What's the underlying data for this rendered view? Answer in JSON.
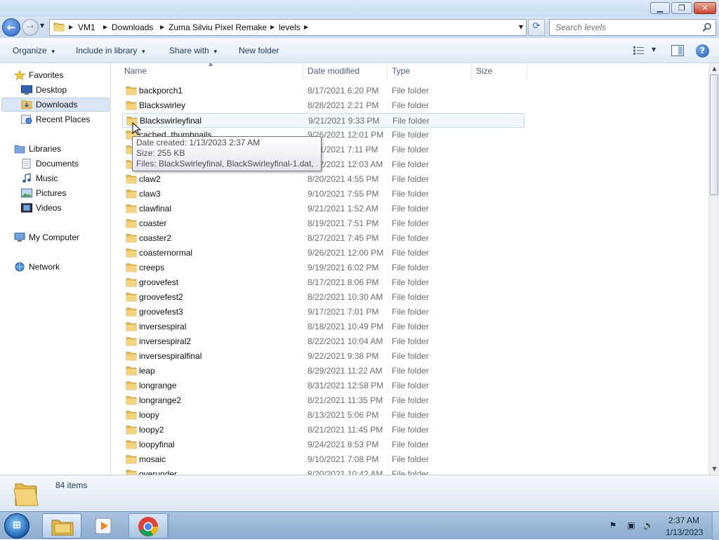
{
  "window": {
    "caption_minimize": "▁",
    "caption_maximize": "❐",
    "caption_close": "✕"
  },
  "address": {
    "crumbs": [
      "VM1",
      "Downloads",
      "Zuma Silviu Pixel Remake",
      "levels"
    ],
    "search_placeholder": "Search levels"
  },
  "toolbar": {
    "organize": "Organize",
    "include_in_library": "Include in library",
    "share_with": "Share with",
    "new_folder": "New folder",
    "help": "?"
  },
  "navpane": {
    "favorites": "Favorites",
    "desktop": "Desktop",
    "downloads": "Downloads",
    "recent_places": "Recent Places",
    "libraries": "Libraries",
    "documents": "Documents",
    "music": "Music",
    "pictures": "Pictures",
    "videos": "Videos",
    "my_computer": "My Computer",
    "network": "Network"
  },
  "columns": {
    "name": "Name",
    "date_modified": "Date modified",
    "type": "Type",
    "size": "Size"
  },
  "files": [
    {
      "name": "backporch1",
      "date": "8/17/2021 6:20 PM",
      "type": "File folder"
    },
    {
      "name": "Blackswirley",
      "date": "8/28/2021 2:21 PM",
      "type": "File folder"
    },
    {
      "name": "Blackswirleyfinal",
      "date": "9/21/2021 9:33 PM",
      "type": "File folder"
    },
    {
      "name": "cached_thumbnails",
      "date": "9/26/2021 12:01 PM",
      "type": "File folder"
    },
    {
      "name": "",
      "date": "9/21/2021 7:11 PM",
      "type": "File folder"
    },
    {
      "name": "",
      "date": "9/22/2021 12:03 AM",
      "type": "File folder"
    },
    {
      "name": "claw2",
      "date": "8/20/2021 4:55 PM",
      "type": "File folder"
    },
    {
      "name": "claw3",
      "date": "9/10/2021 7:55 PM",
      "type": "File folder"
    },
    {
      "name": "clawfinal",
      "date": "9/21/2021 1:52 AM",
      "type": "File folder"
    },
    {
      "name": "coaster",
      "date": "8/19/2021 7:51 PM",
      "type": "File folder"
    },
    {
      "name": "coaster2",
      "date": "8/27/2021 7:45 PM",
      "type": "File folder"
    },
    {
      "name": "coasternormal",
      "date": "9/26/2021 12:00 PM",
      "type": "File folder"
    },
    {
      "name": "creeps",
      "date": "9/19/2021 6:02 PM",
      "type": "File folder"
    },
    {
      "name": "groovefest",
      "date": "8/17/2021 8:06 PM",
      "type": "File folder"
    },
    {
      "name": "groovefest2",
      "date": "8/22/2021 10:30 AM",
      "type": "File folder"
    },
    {
      "name": "groovefest3",
      "date": "9/17/2021 7:01 PM",
      "type": "File folder"
    },
    {
      "name": "inversespiral",
      "date": "8/18/2021 10:49 PM",
      "type": "File folder"
    },
    {
      "name": "inversespiral2",
      "date": "8/22/2021 10:04 AM",
      "type": "File folder"
    },
    {
      "name": "inversespiralfinal",
      "date": "9/22/2021 9:38 PM",
      "type": "File folder"
    },
    {
      "name": "leap",
      "date": "8/29/2021 11:22 AM",
      "type": "File folder"
    },
    {
      "name": "longrange",
      "date": "8/31/2021 12:58 PM",
      "type": "File folder"
    },
    {
      "name": "longrange2",
      "date": "8/21/2021 11:35 PM",
      "type": "File folder"
    },
    {
      "name": "loopy",
      "date": "8/13/2021 5:06 PM",
      "type": "File folder"
    },
    {
      "name": "loopy2",
      "date": "8/21/2021 11:45 PM",
      "type": "File folder"
    },
    {
      "name": "loopyfinal",
      "date": "9/24/2021 8:53 PM",
      "type": "File folder"
    },
    {
      "name": "mosaic",
      "date": "9/10/2021 7:08 PM",
      "type": "File folder"
    },
    {
      "name": "overunder",
      "date": "8/20/2021 10:42 AM",
      "type": "File folder"
    }
  ],
  "tooltip": {
    "date_created": "Date created: 1/13/2023 2:37 AM",
    "size": "Size: 255 KB",
    "files": "Files: BlackSwirleyfinal, BlackSwirleyfinal-1.dat, ..."
  },
  "status": {
    "item_count": "84 items"
  },
  "taskbar": {
    "time": "2:37 AM",
    "date": "1/13/2023"
  },
  "colors": {
    "accent": "#1e395b",
    "selection": "#c9dcf1"
  }
}
